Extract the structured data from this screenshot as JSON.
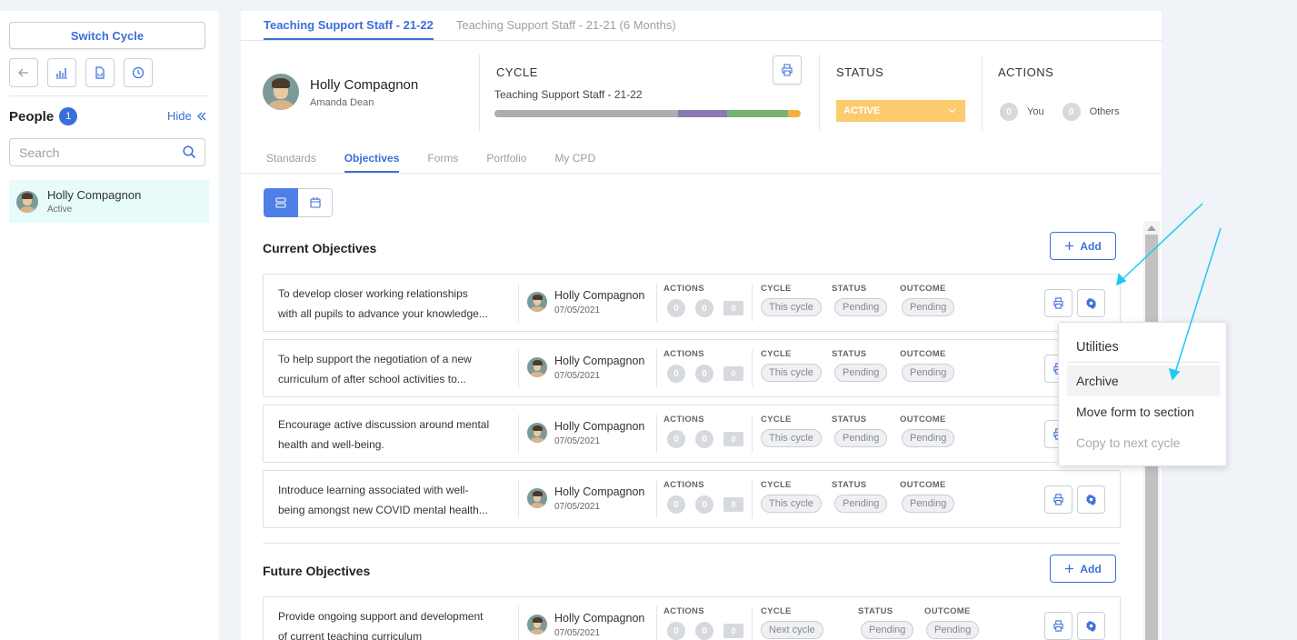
{
  "sidebar": {
    "switch_cycle": "Switch Cycle",
    "people_title": "People",
    "people_count": "1",
    "hide_label": "Hide",
    "search_placeholder": "Search",
    "person": {
      "name": "Holly Compagnon",
      "status": "Active"
    }
  },
  "tabs": [
    "Teaching Support Staff - 21-22",
    "Teaching Support Staff - 21-21 (6 Months)"
  ],
  "header": {
    "name": "Holly Compagnon",
    "role": "Amanda Dean",
    "cycle_label": "CYCLE",
    "cycle_name": "Teaching Support Staff - 21-22",
    "cycle_progress": [
      {
        "fraction": 0.6,
        "color": "#acadb0"
      },
      {
        "fraction": 0.16,
        "color": "#8c79b3"
      },
      {
        "fraction": 0.2,
        "color": "#79b273"
      },
      {
        "fraction": 0.04,
        "color": "#f5ae3e"
      }
    ],
    "status_label": "STATUS",
    "status_value": "ACTIVE",
    "actions_label": "ACTIONS",
    "you_count": "0",
    "you_label": "You",
    "others_count": "0",
    "others_label": "Others"
  },
  "subtabs": [
    "Standards",
    "Objectives",
    "Forms",
    "Portfolio",
    "My CPD"
  ],
  "current_section": {
    "title": "Current Objectives",
    "add_label": "Add"
  },
  "future_section": {
    "title": "Future Objectives",
    "add_label": "Add"
  },
  "col_labels": {
    "actions": "ACTIONS",
    "cycle": "CYCLE",
    "status": "STATUS",
    "outcome": "OUTCOME"
  },
  "objectives": [
    {
      "line1": "To develop closer working relationships",
      "line2": "with all pupils to advance your knowledge...",
      "name": "Holly Compagnon",
      "date": "07/05/2021",
      "a1": "0",
      "a2": "0",
      "a3": "0",
      "cycle": "This cycle",
      "status": "Pending",
      "outcome": "Pending"
    },
    {
      "line1": "To help support the negotiation of a new",
      "line2": "curriculum of after school activities to...",
      "name": "Holly Compagnon",
      "date": "07/05/2021",
      "a1": "0",
      "a2": "0",
      "a3": "0",
      "cycle": "This cycle",
      "status": "Pending",
      "outcome": "Pending"
    },
    {
      "line1": "Encourage active discussion around mental",
      "line2": "health and well-being.",
      "name": "Holly Compagnon",
      "date": "07/05/2021",
      "a1": "0",
      "a2": "0",
      "a3": "0",
      "cycle": "This cycle",
      "status": "Pending",
      "outcome": "Pending"
    },
    {
      "line1": "Introduce learning associated with well-",
      "line2": "being amongst new COVID mental health...",
      "name": "Holly Compagnon",
      "date": "07/05/2021",
      "a1": "0",
      "a2": "0",
      "a3": "0",
      "cycle": "This cycle",
      "status": "Pending",
      "outcome": "Pending"
    }
  ],
  "future_objectives": [
    {
      "line1": "Provide ongoing support and development",
      "line2": "of current teaching curriculum",
      "name": "Holly Compagnon",
      "date": "07/05/2021",
      "a1": "0",
      "a2": "0",
      "a3": "0",
      "cycle": "Next cycle",
      "status": "Pending",
      "outcome": "Pending"
    }
  ],
  "menu": {
    "header": "Utilities",
    "items": [
      "Archive",
      "Move form to section",
      "Copy to next cycle"
    ]
  },
  "colors": {
    "accent": "#3b6fd8",
    "status": "#fccb6e",
    "annotation": "#1ec8f0"
  }
}
